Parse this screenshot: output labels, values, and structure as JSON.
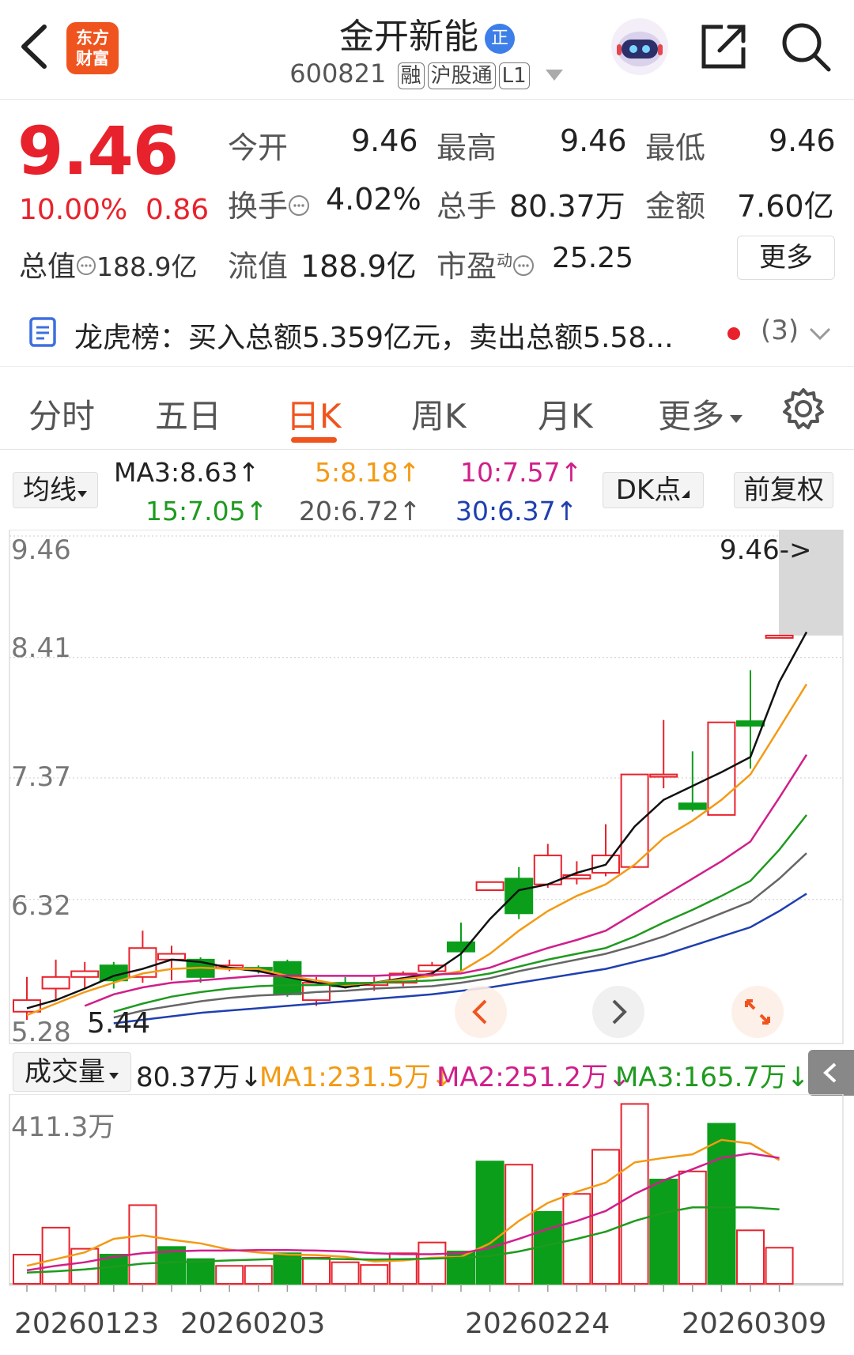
{
  "header": {
    "logo_text_1": "东方",
    "logo_text_2": "财富",
    "stock_name": "金开新能",
    "zheng_badge": "正",
    "stock_code": "600821",
    "tags": [
      "融",
      "沪股通",
      "L1"
    ]
  },
  "quote": {
    "price": "9.46",
    "change_pct": "10.00%",
    "change_amt": "0.86",
    "market_cap_label": "总值",
    "market_cap": "188.9亿",
    "open_label": "今开",
    "open": "9.46",
    "high_label": "最高",
    "high": "9.46",
    "low_label": "最低",
    "low": "9.46",
    "turnover_label": "换手",
    "turnover": "4.02%",
    "volume_label": "总手",
    "volume": "80.37万",
    "amount_label": "金额",
    "amount": "7.60亿",
    "float_cap_label": "流值",
    "float_cap": "188.9亿",
    "pe_label": "市盈",
    "pe_sup": "动",
    "pe": "25.25",
    "more_label": "更多"
  },
  "longhubang": {
    "text": "龙虎榜：买入总额5.359亿元，卖出总额5.58...",
    "count": "(3)"
  },
  "tabs": [
    "分时",
    "五日",
    "日K",
    "周K",
    "月K",
    "更多"
  ],
  "active_tab": "日K",
  "ma_bar": {
    "avg_label": "均线",
    "ma3": "MA3:8.63↑",
    "ma5": "5:8.18↑",
    "ma10": "10:7.57↑",
    "ma15": "15:7.05↑",
    "ma20": "20:6.72↑",
    "ma30": "30:6.37↑",
    "dk_label": "DK点",
    "fq_label": "前复权"
  },
  "colors": {
    "up": "#e8222c",
    "down": "#0a9e1a",
    "ma3": "#111111",
    "ma5": "#f39a14",
    "ma10": "#d01f8a",
    "ma15": "#1f9a1f",
    "ma20": "#666666",
    "ma30": "#1f3fb0",
    "accent": "#f0541e"
  },
  "chart_data": [
    {
      "type": "candlestick",
      "y_ticks": [
        "9.46",
        "8.41",
        "7.37",
        "6.32",
        "5.28"
      ],
      "last_price_marker": "9.46->",
      "min_marker": "5.44",
      "x_labels": [
        "20260123",
        "20260203",
        "20260224",
        "20260309"
      ],
      "ylim": [
        5.28,
        9.46
      ],
      "candles": [
        {
          "o": 5.35,
          "c": 5.45,
          "h": 5.65,
          "l": 5.28,
          "up": true
        },
        {
          "o": 5.55,
          "c": 5.65,
          "h": 5.8,
          "l": 5.45,
          "up": true
        },
        {
          "o": 5.65,
          "c": 5.7,
          "h": 5.78,
          "l": 5.55,
          "up": true
        },
        {
          "o": 5.75,
          "c": 5.62,
          "h": 5.78,
          "l": 5.55,
          "up": false
        },
        {
          "o": 5.65,
          "c": 5.9,
          "h": 6.05,
          "l": 5.6,
          "up": true
        },
        {
          "o": 5.8,
          "c": 5.85,
          "h": 5.92,
          "l": 5.62,
          "up": true
        },
        {
          "o": 5.8,
          "c": 5.65,
          "h": 5.82,
          "l": 5.6,
          "up": false
        },
        {
          "o": 5.73,
          "c": 5.75,
          "h": 5.8,
          "l": 5.7,
          "up": true
        },
        {
          "o": 5.73,
          "c": 5.71,
          "h": 5.75,
          "l": 5.68,
          "up": false
        },
        {
          "o": 5.78,
          "c": 5.5,
          "h": 5.8,
          "l": 5.48,
          "up": false
        },
        {
          "o": 5.45,
          "c": 5.6,
          "h": 5.65,
          "l": 5.4,
          "up": true
        },
        {
          "o": 5.6,
          "c": 5.57,
          "h": 5.65,
          "l": 5.55,
          "up": false
        },
        {
          "o": 5.58,
          "c": 5.6,
          "h": 5.65,
          "l": 5.53,
          "up": true
        },
        {
          "o": 5.6,
          "c": 5.68,
          "h": 5.7,
          "l": 5.57,
          "up": true
        },
        {
          "o": 5.7,
          "c": 5.75,
          "h": 5.78,
          "l": 5.65,
          "up": true
        },
        {
          "o": 5.95,
          "c": 5.87,
          "h": 6.12,
          "l": 5.7,
          "up": false
        },
        {
          "o": 6.4,
          "c": 6.47,
          "h": 6.47,
          "l": 6.4,
          "up": true
        },
        {
          "o": 6.5,
          "c": 6.2,
          "h": 6.6,
          "l": 6.15,
          "up": false
        },
        {
          "o": 6.45,
          "c": 6.7,
          "h": 6.8,
          "l": 6.42,
          "up": true
        },
        {
          "o": 6.5,
          "c": 6.53,
          "h": 6.65,
          "l": 6.45,
          "up": true
        },
        {
          "o": 6.55,
          "c": 6.7,
          "h": 6.97,
          "l": 6.52,
          "up": true
        },
        {
          "o": 6.6,
          "c": 7.4,
          "h": 7.4,
          "l": 6.6,
          "up": true
        },
        {
          "o": 7.4,
          "c": 7.4,
          "h": 7.87,
          "l": 7.28,
          "up": true
        },
        {
          "o": 7.15,
          "c": 7.1,
          "h": 7.6,
          "l": 7.08,
          "up": false
        },
        {
          "o": 7.05,
          "c": 7.85,
          "h": 7.85,
          "l": 7.05,
          "up": true
        },
        {
          "o": 7.86,
          "c": 7.82,
          "h": 8.3,
          "l": 7.45,
          "up": false
        },
        {
          "o": 8.6,
          "c": 8.6,
          "h": 8.6,
          "l": 8.6,
          "up": true
        }
      ],
      "series": [
        {
          "name": "MA3",
          "values": [
            5.38,
            5.45,
            5.55,
            5.66,
            5.72,
            5.8,
            5.78,
            5.73,
            5.7,
            5.65,
            5.6,
            5.56,
            5.6,
            5.64,
            5.68,
            5.85,
            6.15,
            6.4,
            6.45,
            6.55,
            6.62,
            6.95,
            7.18,
            7.3,
            7.42,
            7.55,
            8.2,
            8.63
          ]
        },
        {
          "name": "MA5",
          "values": [
            5.32,
            5.42,
            5.52,
            5.6,
            5.68,
            5.72,
            5.73,
            5.72,
            5.72,
            5.66,
            5.62,
            5.58,
            5.6,
            5.63,
            5.66,
            5.7,
            5.85,
            6.05,
            6.22,
            6.35,
            6.45,
            6.62,
            6.85,
            7.0,
            7.18,
            7.4,
            7.8,
            8.18
          ]
        },
        {
          "name": "MA10",
          "values": [
            null,
            null,
            5.4,
            5.5,
            5.56,
            5.6,
            5.62,
            5.64,
            5.66,
            5.66,
            5.66,
            5.66,
            5.66,
            5.67,
            5.67,
            5.68,
            5.73,
            5.82,
            5.9,
            5.97,
            6.05,
            6.2,
            6.35,
            6.5,
            6.65,
            6.82,
            7.2,
            7.57
          ]
        },
        {
          "name": "MA15",
          "values": [
            null,
            null,
            null,
            5.35,
            5.42,
            5.48,
            5.52,
            5.55,
            5.57,
            5.58,
            5.58,
            5.59,
            5.6,
            5.61,
            5.62,
            5.64,
            5.68,
            5.74,
            5.8,
            5.85,
            5.9,
            6.0,
            6.12,
            6.23,
            6.35,
            6.48,
            6.75,
            7.05
          ]
        },
        {
          "name": "MA20",
          "values": [
            null,
            null,
            null,
            5.3,
            5.36,
            5.4,
            5.44,
            5.47,
            5.49,
            5.5,
            5.52,
            5.53,
            5.55,
            5.56,
            5.57,
            5.6,
            5.64,
            5.7,
            5.75,
            5.8,
            5.85,
            5.92,
            6.0,
            6.1,
            6.2,
            6.3,
            6.5,
            6.72
          ]
        },
        {
          "name": "MA30",
          "values": [
            null,
            null,
            null,
            5.25,
            5.28,
            5.31,
            5.34,
            5.36,
            5.38,
            5.4,
            5.42,
            5.44,
            5.46,
            5.48,
            5.5,
            5.53,
            5.56,
            5.6,
            5.64,
            5.68,
            5.72,
            5.78,
            5.84,
            5.92,
            6.0,
            6.08,
            6.22,
            6.37
          ]
        }
      ]
    },
    {
      "type": "bar",
      "title": "成交量",
      "current": "80.37万↓",
      "ma1": "MA1:231.5万↓",
      "ma2": "MA2:251.2万↓",
      "ma3": "MA3:165.7万↓",
      "y_tick": "411.3万",
      "ylim": [
        0,
        411.3
      ],
      "values": [
        65,
        125,
        78,
        65,
        175,
        82,
        55,
        40,
        40,
        68,
        58,
        48,
        42,
        68,
        92,
        72,
        272,
        265,
        160,
        200,
        298,
        400,
        232,
        250,
        356,
        119,
        80.37
      ],
      "up": [
        true,
        true,
        true,
        false,
        true,
        false,
        false,
        true,
        true,
        false,
        true,
        true,
        true,
        true,
        true,
        false,
        false,
        true,
        false,
        true,
        true,
        true,
        false,
        true,
        false,
        true,
        true
      ],
      "series": [
        {
          "name": "MA1",
          "values": [
            40,
            55,
            70,
            100,
            108,
            98,
            90,
            76,
            70,
            65,
            64,
            60,
            50,
            52,
            58,
            60,
            90,
            140,
            180,
            205,
            225,
            270,
            280,
            288,
            320,
            312,
            275
          ]
        },
        {
          "name": "MA2",
          "values": [
            30,
            40,
            48,
            60,
            68,
            72,
            74,
            74,
            75,
            75,
            74,
            72,
            68,
            66,
            66,
            68,
            80,
            100,
            122,
            140,
            162,
            200,
            230,
            255,
            280,
            290,
            280
          ]
        },
        {
          "name": "MA3",
          "values": [
            25,
            28,
            32,
            38,
            45,
            48,
            50,
            52,
            54,
            56,
            56,
            55,
            54,
            55,
            56,
            58,
            62,
            72,
            86,
            100,
            116,
            140,
            158,
            170,
            170,
            170,
            165.7
          ]
        }
      ]
    }
  ]
}
